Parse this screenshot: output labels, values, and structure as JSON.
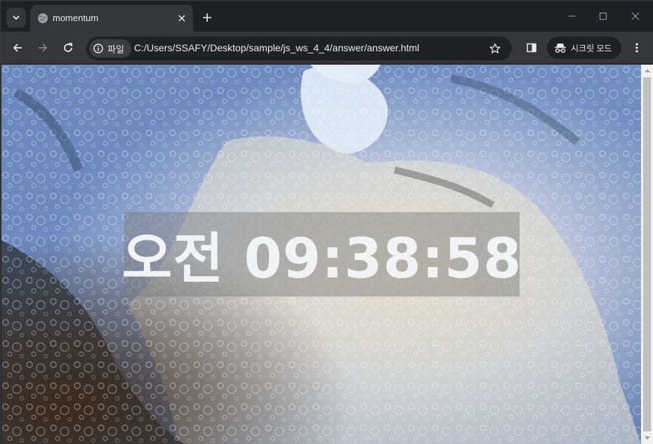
{
  "browser": {
    "tab": {
      "title": "momentum",
      "favicon": "globe-icon"
    },
    "toolbar": {
      "site_chip_label": "파일",
      "url": "C:/Users/SSAFY/Desktop/sample/js_ws_4_4/answer/answer.html",
      "incognito_label": "시크릿 모드"
    }
  },
  "page": {
    "clock": "오전 09:38:58"
  },
  "colors": {
    "chrome_dark": "#202124",
    "toolbar": "#35363a",
    "text": "#e8eaed",
    "clock_box": "rgba(120,120,120,0.45)"
  }
}
